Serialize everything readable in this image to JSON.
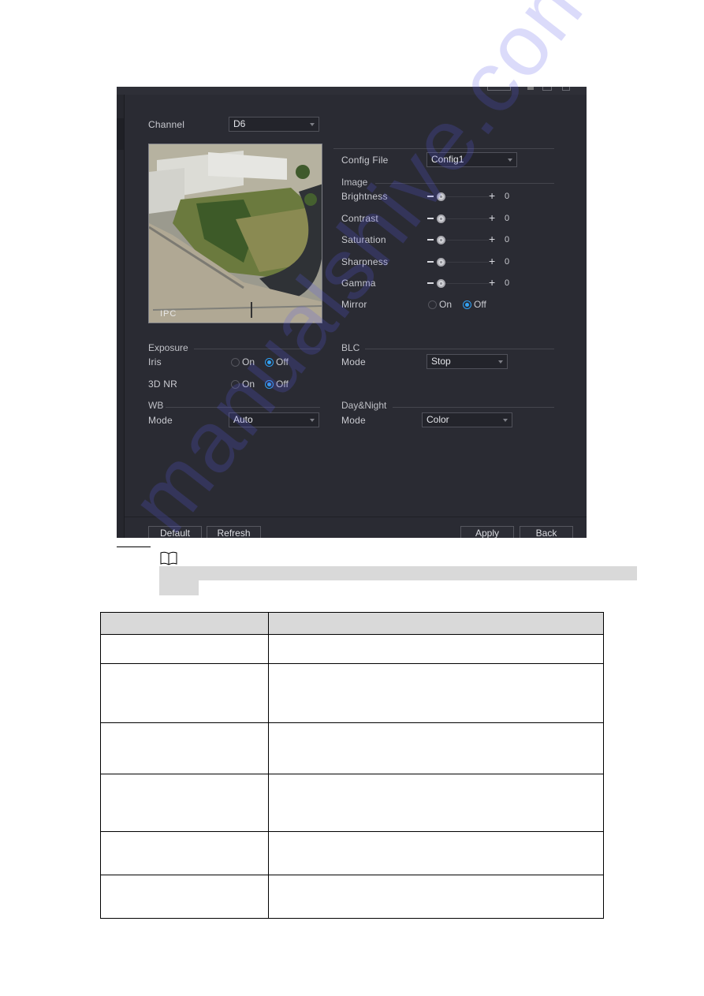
{
  "screen": {
    "channel": {
      "label": "Channel",
      "value": "D6"
    },
    "preview": {
      "overlay_text": "IPC"
    },
    "config_file": {
      "label": "Config File",
      "value": "Config1"
    },
    "image": {
      "title": "Image",
      "sliders": [
        {
          "label": "Brightness",
          "value": "0"
        },
        {
          "label": "Contrast",
          "value": "0"
        },
        {
          "label": "Saturation",
          "value": "0"
        },
        {
          "label": "Sharpness",
          "value": "0"
        },
        {
          "label": "Gamma",
          "value": "0"
        }
      ],
      "mirror": {
        "label": "Mirror",
        "on": "On",
        "off": "Off",
        "selected": "Off"
      }
    },
    "exposure": {
      "title": "Exposure",
      "iris": {
        "label": "Iris",
        "on": "On",
        "off": "Off",
        "selected": "Off"
      },
      "nr3d": {
        "label": "3D NR",
        "on": "On",
        "off": "Off",
        "selected": "Off"
      }
    },
    "blc": {
      "title": "BLC",
      "mode_label": "Mode",
      "mode_value": "Stop"
    },
    "wb": {
      "title": "WB",
      "mode_label": "Mode",
      "mode_value": "Auto"
    },
    "day_night": {
      "title": "Day&Night",
      "mode_label": "Mode",
      "mode_value": "Color"
    },
    "buttons": {
      "default": "Default",
      "refresh": "Refresh",
      "apply": "Apply",
      "back": "Back"
    },
    "accent_color": "#33a3f4"
  },
  "watermark": "manualshive.com",
  "note": {
    "icon": "book-icon"
  },
  "table": {
    "header": [
      "",
      ""
    ],
    "rows": [
      [
        "",
        ""
      ],
      [
        "",
        ""
      ],
      [
        "",
        ""
      ],
      [
        "",
        ""
      ],
      [
        "",
        ""
      ],
      [
        "",
        ""
      ]
    ]
  }
}
